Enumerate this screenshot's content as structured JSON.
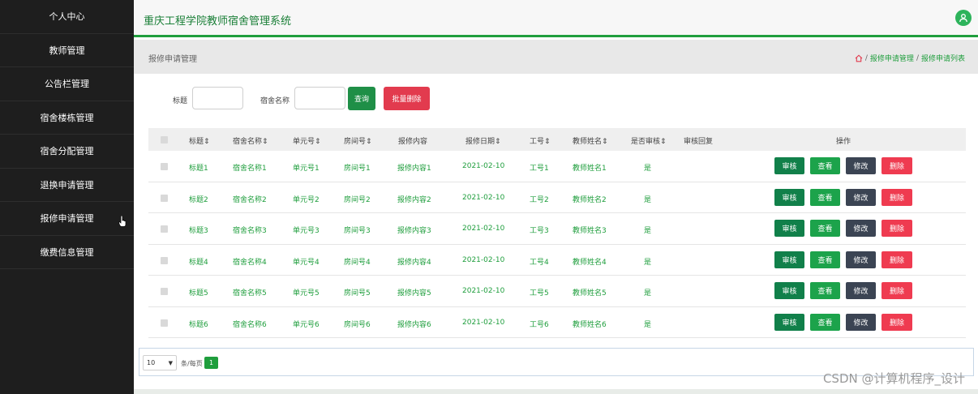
{
  "sidebar": {
    "items": [
      {
        "label": "个人中心"
      },
      {
        "label": "教师管理"
      },
      {
        "label": "公告栏管理"
      },
      {
        "label": "宿舍楼栋管理"
      },
      {
        "label": "宿舍分配管理"
      },
      {
        "label": "退换申请管理"
      },
      {
        "label": "报修申请管理"
      },
      {
        "label": "缴费信息管理"
      }
    ]
  },
  "header": {
    "title": "重庆工程学院教师宿舍管理系统",
    "avatar_icon": "user-icon"
  },
  "subbar": {
    "title": "报修申请管理",
    "breadcrumb": [
      "报修申请管理",
      "报修申请列表"
    ],
    "separator": "/"
  },
  "search": {
    "title_label": "标题",
    "dorm_label": "宿舍名称",
    "query_button": "查询",
    "batch_delete_button": "批量删除"
  },
  "table": {
    "columns": [
      "标题",
      "宿舍名称",
      "单元号",
      "房间号",
      "报修内容",
      "报修日期",
      "工号",
      "教师姓名",
      "是否审核",
      "审核回复",
      "操作"
    ],
    "sortable_columns": [
      "标题",
      "宿舍名称",
      "单元号",
      "房间号",
      "报修日期",
      "工号",
      "教师姓名",
      "是否审核"
    ],
    "rows": [
      {
        "title": "标题1",
        "dorm": "宿舍名称1",
        "unit": "单元号1",
        "room": "房间号1",
        "content": "报修内容1",
        "date": "2021-02-10",
        "job_no": "工号1",
        "teacher": "教师姓名1",
        "audited": "是",
        "reply": ""
      },
      {
        "title": "标题2",
        "dorm": "宿舍名称2",
        "unit": "单元号2",
        "room": "房间号2",
        "content": "报修内容2",
        "date": "2021-02-10",
        "job_no": "工号2",
        "teacher": "教师姓名2",
        "audited": "是",
        "reply": ""
      },
      {
        "title": "标题3",
        "dorm": "宿舍名称3",
        "unit": "单元号3",
        "room": "房间号3",
        "content": "报修内容3",
        "date": "2021-02-10",
        "job_no": "工号3",
        "teacher": "教师姓名3",
        "audited": "是",
        "reply": ""
      },
      {
        "title": "标题4",
        "dorm": "宿舍名称4",
        "unit": "单元号4",
        "room": "房间号4",
        "content": "报修内容4",
        "date": "2021-02-10",
        "job_no": "工号4",
        "teacher": "教师姓名4",
        "audited": "是",
        "reply": ""
      },
      {
        "title": "标题5",
        "dorm": "宿舍名称5",
        "unit": "单元号5",
        "room": "房间号5",
        "content": "报修内容5",
        "date": "2021-02-10",
        "job_no": "工号5",
        "teacher": "教师姓名5",
        "audited": "是",
        "reply": ""
      },
      {
        "title": "标题6",
        "dorm": "宿舍名称6",
        "unit": "单元号6",
        "room": "房间号6",
        "content": "报修内容6",
        "date": "2021-02-10",
        "job_no": "工号6",
        "teacher": "教师姓名6",
        "audited": "是",
        "reply": ""
      }
    ],
    "actions": {
      "audit": "审核",
      "view": "查看",
      "edit": "修改",
      "delete": "删除"
    }
  },
  "pagination": {
    "page_size": "10",
    "per_page_label": "条/每页",
    "current_page": "1"
  },
  "watermark": "CSDN @计算机程序_设计",
  "colors": {
    "sidebar_bg": "#1e1e1e",
    "accent": "#1f9e3d",
    "danger": "#ef3b50",
    "dark_button": "#3b4453"
  }
}
